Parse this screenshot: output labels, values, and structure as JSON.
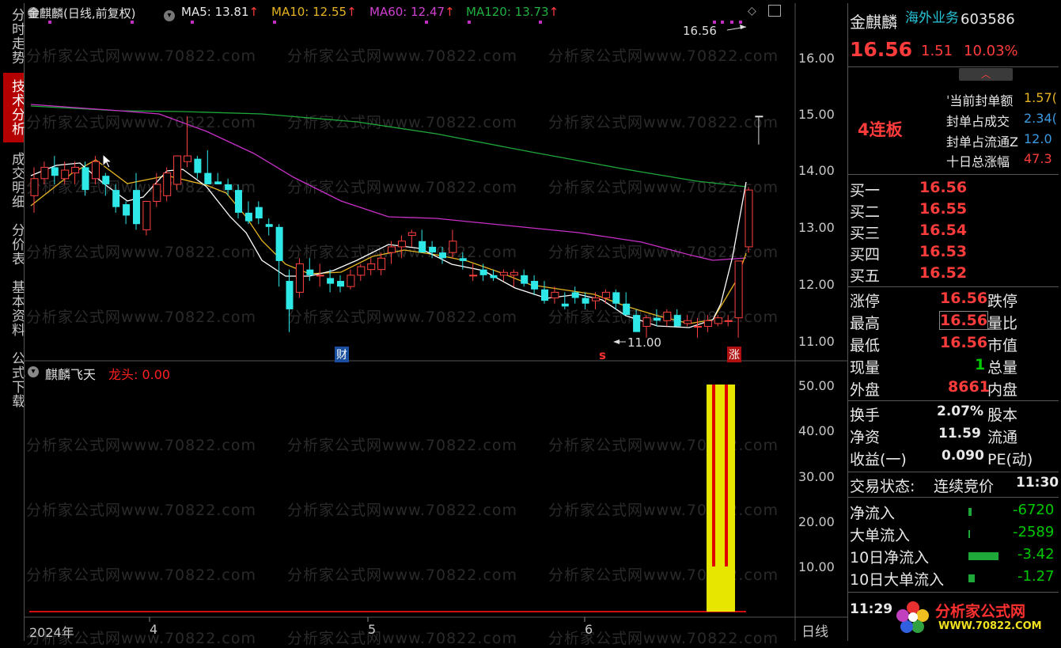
{
  "left_tabs": [
    {
      "label": "分时走势",
      "active": false
    },
    {
      "label": "技术分析",
      "active": true
    },
    {
      "label": "成交明细",
      "active": false
    },
    {
      "label": "分价表",
      "active": false
    },
    {
      "label": "基本资料",
      "active": false
    },
    {
      "label": "公式下载",
      "active": false
    }
  ],
  "header": {
    "stock_title": "金麒麟(日线,前复权)",
    "ma5": "MA5: 13.81",
    "ma10": "MA10: 12.55",
    "ma60": "MA60: 12.47",
    "ma120": "MA120: 13.73",
    "up_arrow": "↑"
  },
  "price_axis": [
    "16.00",
    "15.00",
    "14.00",
    "13.00",
    "12.00",
    "11.00"
  ],
  "indicator_axis": [
    "50.00",
    "40.00",
    "30.00",
    "20.00",
    "10.00"
  ],
  "annotations": {
    "high_label": "16.56",
    "low_label": "11.00",
    "cai_marker": "财",
    "s_marker": "s",
    "zhang_marker": "涨"
  },
  "indicator": {
    "name": "麒麟飞天",
    "param_label": "龙头: 0.00"
  },
  "time_axis": {
    "labels": [
      "2024年",
      "4",
      "5",
      "6"
    ],
    "period": "日线"
  },
  "watermark": "分析家公式网www.70822.com",
  "colors": {
    "ma5": "#ffffff",
    "ma10": "#e6b422",
    "ma60": "#c830c8",
    "ma120": "#1fa83a",
    "up": "#ff4040",
    "down": "#2ee8e8"
  },
  "right": {
    "name": "金麒麟",
    "tag": "海外业务",
    "code": "603586",
    "price": "16.56",
    "change": "1.51",
    "pct": "10.03%",
    "lianban": "4连板",
    "seal_items": [
      {
        "label": "当前封单额",
        "value": "1.57("
      },
      {
        "label": "封单占成交",
        "value": "2.34("
      },
      {
        "label": "封单占流通Z",
        "value": "12.0"
      },
      {
        "label": "十日总涨幅",
        "value": "47.3"
      }
    ],
    "bids": [
      {
        "label": "买一",
        "value": "16.56"
      },
      {
        "label": "买二",
        "value": "16.55"
      },
      {
        "label": "买三",
        "value": "16.54"
      },
      {
        "label": "买四",
        "value": "16.53"
      },
      {
        "label": "买五",
        "value": "16.52"
      }
    ],
    "quote_rows": [
      {
        "l1": "涨停",
        "v1": "16.56",
        "l2": "跌停"
      },
      {
        "l1": "最高",
        "v1": "16.56",
        "l2": "量比"
      },
      {
        "l1": "最低",
        "v1": "16.56",
        "l2": "市值"
      },
      {
        "l1": "现量",
        "v1": "1",
        "l2": "总量"
      },
      {
        "l1": "外盘",
        "v1": "8661",
        "l2": "内盘"
      }
    ],
    "fund_rows": [
      {
        "l1": "换手",
        "v1": "2.07%",
        "l2": "股本"
      },
      {
        "l1": "净资",
        "v1": "11.59",
        "l2": "流通"
      },
      {
        "l1": "收益(一)",
        "v1": "0.090",
        "l2": "PE(动)"
      }
    ],
    "trade_status_label": "交易状态:",
    "trade_status_value": "连续竞价",
    "trade_time": "11:30",
    "flows": [
      {
        "label": "净流入",
        "value": "-6720"
      },
      {
        "label": "大单流入",
        "value": "-2589"
      },
      {
        "label": "10日净流入",
        "value": "-3.42"
      },
      {
        "label": "10日大单流入",
        "value": "-1.27"
      }
    ],
    "clock": "11:29",
    "logo_text": "分析家公式网",
    "logo_url": "WWW.70822.COM"
  }
}
